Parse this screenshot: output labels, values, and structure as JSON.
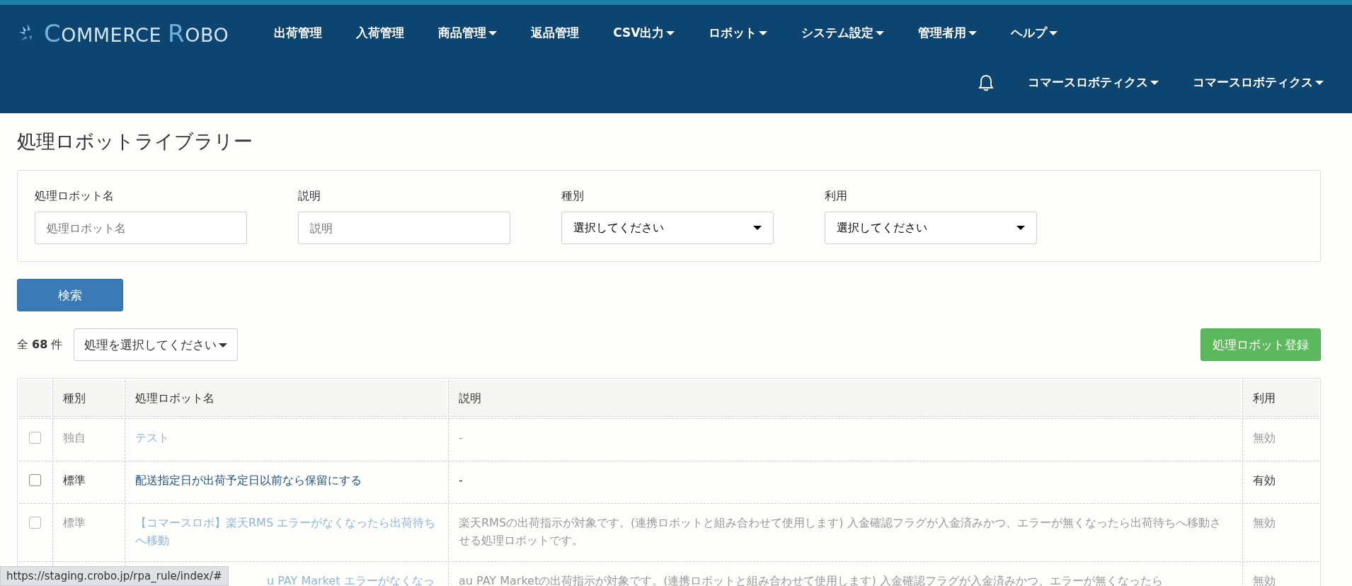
{
  "brand": {
    "name_part1": "C",
    "name_part2": "OMMERCE ",
    "name_part3": "R",
    "name_part4": "OBO"
  },
  "nav": [
    {
      "label": "出荷管理",
      "dropdown": false
    },
    {
      "label": "入荷管理",
      "dropdown": false
    },
    {
      "label": "商品管理",
      "dropdown": true
    },
    {
      "label": "返品管理",
      "dropdown": false
    },
    {
      "label": "CSV出力",
      "dropdown": true
    },
    {
      "label": "ロボット",
      "dropdown": true
    },
    {
      "label": "システム設定",
      "dropdown": true
    },
    {
      "label": "管理者用",
      "dropdown": true
    },
    {
      "label": "ヘルプ",
      "dropdown": true
    }
  ],
  "user_menus": [
    {
      "label": "コマースロボティクス"
    },
    {
      "label": "コマースロボティクス"
    }
  ],
  "page_title": "処理ロボットライブラリー",
  "filters": [
    {
      "kind": "text",
      "label": "処理ロボット名",
      "placeholder": "処理ロボット名"
    },
    {
      "kind": "text",
      "label": "説明",
      "placeholder": "説明"
    },
    {
      "kind": "select",
      "label": "種別",
      "value": "選択してください"
    },
    {
      "kind": "select",
      "label": "利用",
      "value": "選択してください"
    }
  ],
  "search_button": "検索",
  "count": {
    "prefix": "全",
    "number": "68",
    "suffix": "件"
  },
  "action_dropdown": "処理を選択してください",
  "register_button": "処理ロボット登録",
  "table": {
    "columns": [
      "種別",
      "処理ロボット名",
      "説明",
      "利用"
    ],
    "rows": [
      {
        "checked": false,
        "enabled": false,
        "type": "独自",
        "name": "テスト",
        "description": "-",
        "usage": "無効"
      },
      {
        "checked": false,
        "enabled": true,
        "type": "標準",
        "name": "配送指定日が出荷予定日以前なら保留にする",
        "description": "-",
        "usage": "有効"
      },
      {
        "checked": false,
        "enabled": false,
        "type": "標準",
        "name": "【コマースロボ】楽天RMS エラーがなくなったら出荷待ちへ移動",
        "description": "楽天RMSの出荷指示が対象です。(連携ロボットと組み合わせて使用します) 入金確認フラグが入金済みかつ、エラーが無くなったら出荷待ちへ移動させる処理ロボットです。",
        "usage": "無効"
      },
      {
        "enabled": false,
        "name": "u PAY Market エラーがなくなっ",
        "description": "au PAY Marketの出荷指示が対象です。(連携ロボットと組み合わせて使用します) 入金確認フラグが入金済みかつ、エラーが無くなったら",
        "usage": "無効"
      }
    ]
  },
  "status_url": "https://staging.crobo.jp/rpa_rule/index/#"
}
